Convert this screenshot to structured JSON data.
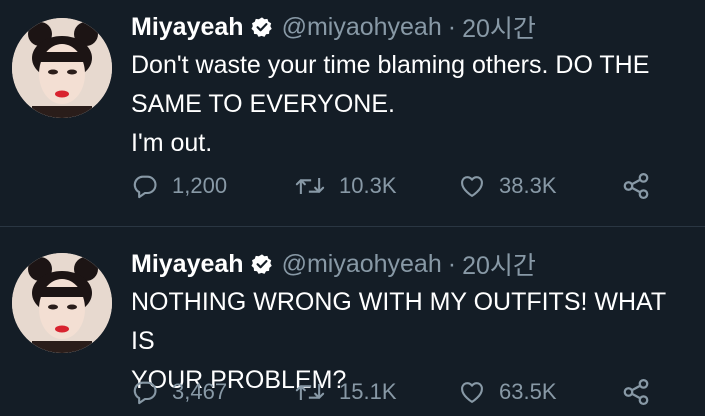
{
  "tweets": [
    {
      "author_name": "Miyayeah",
      "handle": "@miyaohyeah",
      "separator": "·",
      "time": "20시간",
      "text_lines": [
        "Don't waste your time blaming others. DO THE",
        "SAME TO EVERYONE.",
        "I'm out."
      ],
      "replies": "1,200",
      "retweets": "10.3K",
      "likes": "38.3K"
    },
    {
      "author_name": "Miyayeah",
      "handle": "@miyaohyeah",
      "separator": "·",
      "time": "20시간",
      "text_lines": [
        "NOTHING WRONG WITH MY OUTFITS! WHAT IS",
        "YOUR PROBLEM?"
      ],
      "replies": "3,467",
      "retweets": "15.1K",
      "likes": "63.5K"
    }
  ],
  "icons": {
    "verified": "verified-badge-icon",
    "reply": "reply-icon",
    "retweet": "retweet-icon",
    "like": "heart-icon",
    "share": "share-icon"
  },
  "colors": {
    "background": "#141d26",
    "text": "#ffffff",
    "secondary_text": "#8899a6",
    "divider": "#2a3642"
  }
}
